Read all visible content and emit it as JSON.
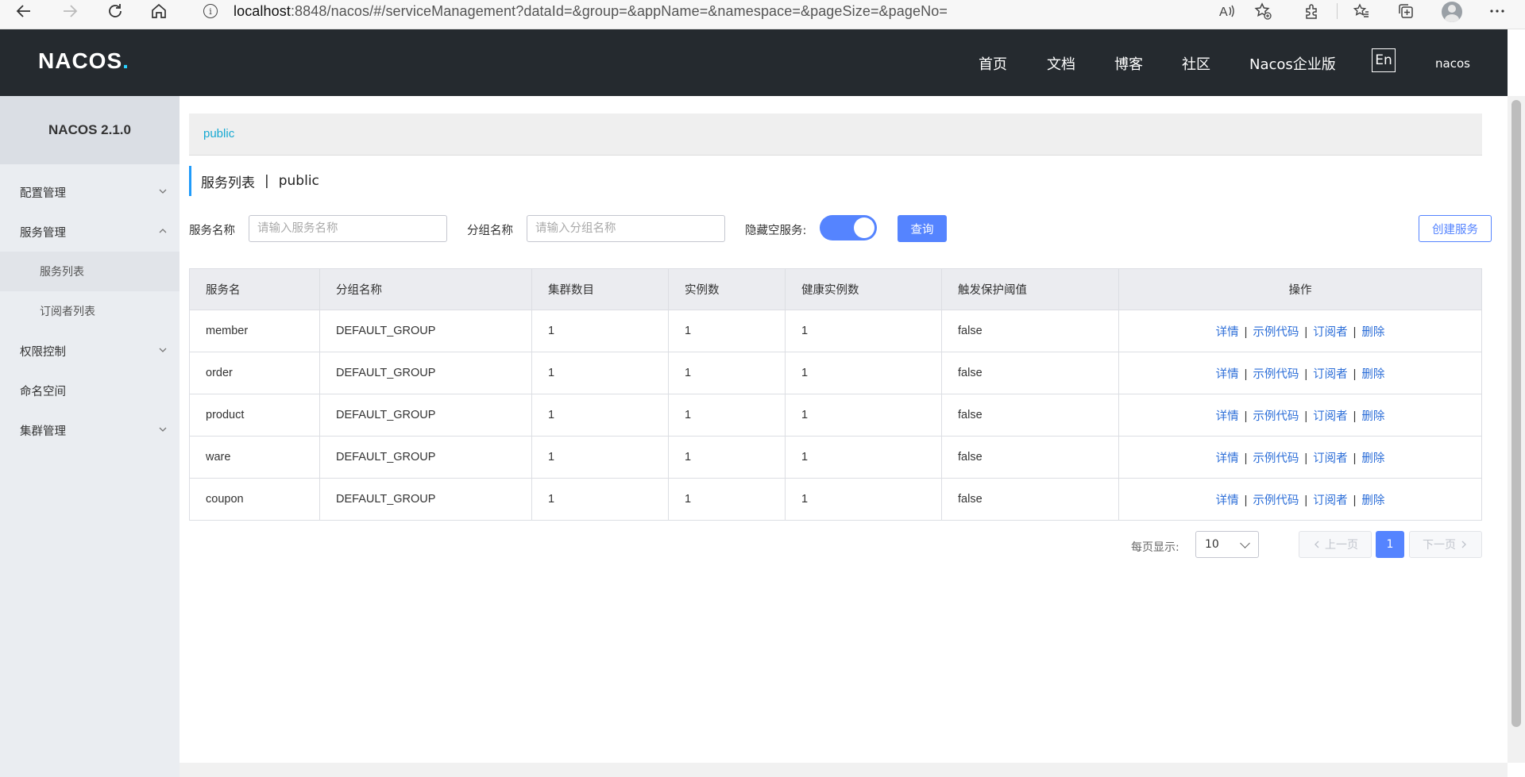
{
  "browser": {
    "url_host": "localhost",
    "url_rest": ":8848/nacos/#/serviceManagement?dataId=&group=&appName=&namespace=&pageSize=&pageNo=",
    "icons": [
      "back-icon",
      "forward-icon",
      "reload-icon",
      "home-icon",
      "info-icon",
      "read-aloud-icon",
      "favorite-add-icon",
      "extensions-icon",
      "favorites-icon",
      "collections-icon",
      "profile-icon",
      "more-icon"
    ]
  },
  "header": {
    "logo_text": "NAC",
    "logo_text2": "OS",
    "logo_dot": ".",
    "nav": [
      "首页",
      "文档",
      "博客",
      "社区",
      "Nacos企业版"
    ],
    "lang": "En",
    "user": "nacos"
  },
  "sidebar": {
    "title": "NACOS 2.1.0",
    "items": [
      {
        "label": "配置管理",
        "chevron": "down"
      },
      {
        "label": "服务管理",
        "chevron": "up"
      },
      {
        "label": "服务列表"
      },
      {
        "label": "订阅者列表"
      },
      {
        "label": "权限控制",
        "chevron": "down"
      },
      {
        "label": "命名空间"
      },
      {
        "label": "集群管理",
        "chevron": "down"
      }
    ]
  },
  "namespace": {
    "current": "public"
  },
  "page": {
    "title": "服务列表",
    "separator": "|",
    "namespace": "public"
  },
  "filters": {
    "service_label": "服务名称",
    "service_placeholder": "请输入服务名称",
    "group_label": "分组名称",
    "group_placeholder": "请输入分组名称",
    "hide_empty_label": "隐藏空服务:",
    "hide_empty_on": true,
    "query_button": "查询",
    "create_button": "创建服务"
  },
  "table": {
    "columns": [
      "服务名",
      "分组名称",
      "集群数目",
      "实例数",
      "健康实例数",
      "触发保护阈值",
      "操作"
    ],
    "rows": [
      [
        "member",
        "DEFAULT_GROUP",
        "1",
        "1",
        "1",
        "false"
      ],
      [
        "order",
        "DEFAULT_GROUP",
        "1",
        "1",
        "1",
        "false"
      ],
      [
        "product",
        "DEFAULT_GROUP",
        "1",
        "1",
        "1",
        "false"
      ],
      [
        "ware",
        "DEFAULT_GROUP",
        "1",
        "1",
        "1",
        "false"
      ],
      [
        "coupon",
        "DEFAULT_GROUP",
        "1",
        "1",
        "1",
        "false"
      ]
    ],
    "actions": [
      "详情",
      "示例代码",
      "订阅者",
      "删除"
    ],
    "action_sep": "|"
  },
  "pagination": {
    "page_size_label": "每页显示:",
    "page_size": "10",
    "prev": "上一页",
    "current_page": "1",
    "next": "下一页"
  },
  "colors": {
    "header_bg": "#252a2f",
    "primary": "#5584ff",
    "link": "#2c6ed8",
    "namespace_link": "#17a9d2"
  }
}
